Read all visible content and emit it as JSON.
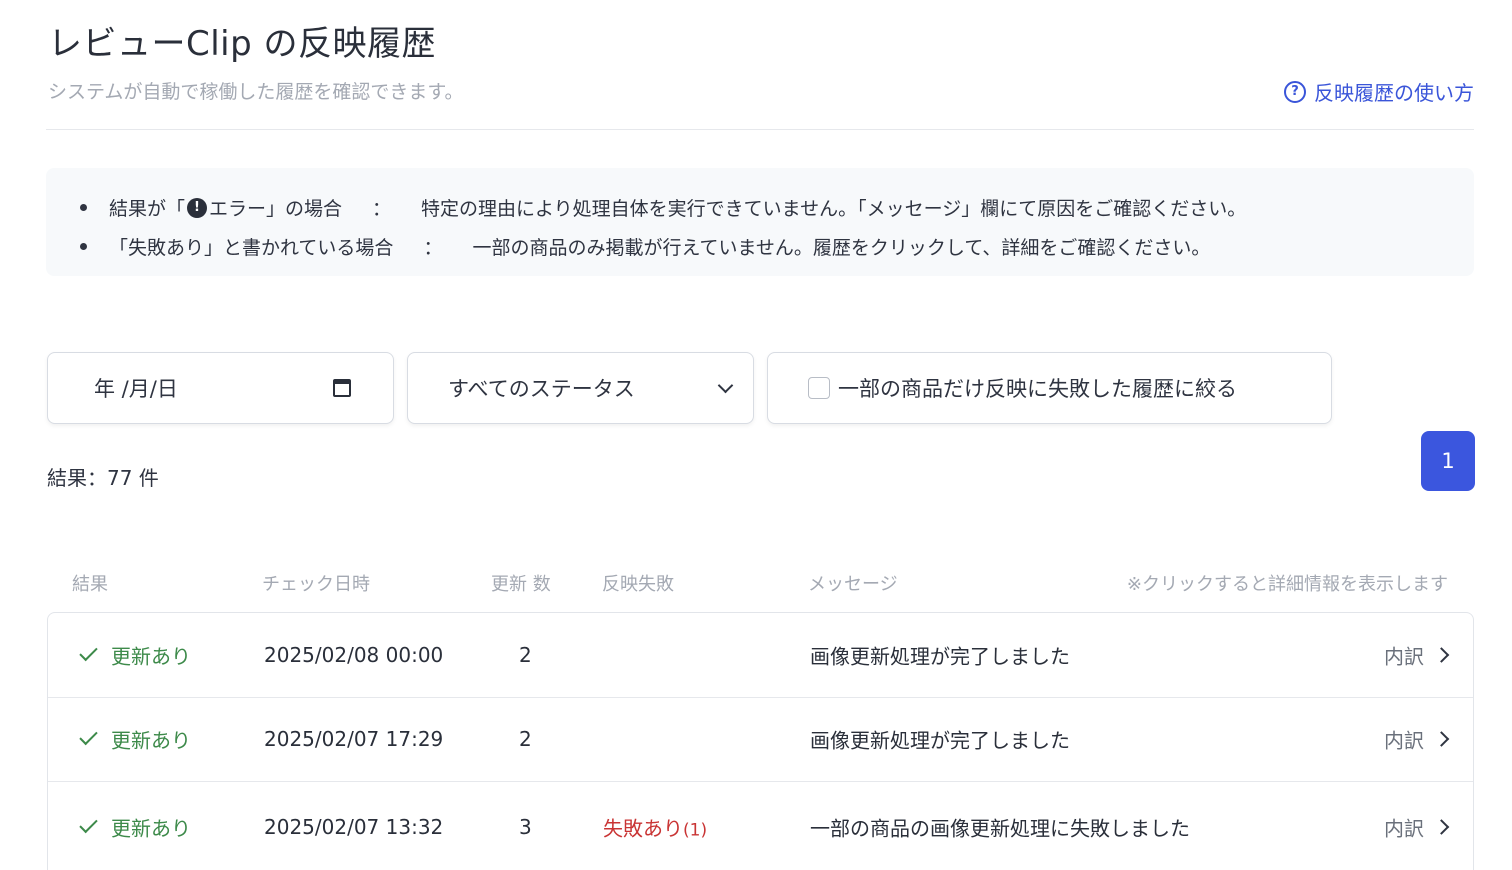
{
  "header": {
    "title": "レビューClip の反映履歴",
    "subtitle": "システムが自動で稼働した履歴を確認できます。",
    "help_link": "反映履歴の使い方",
    "help_icon": "?"
  },
  "notice": {
    "items": [
      {
        "key_prefix": "結果が「",
        "key_icon": "!",
        "key_suffix": " エラー」の場合",
        "separator": "：",
        "text": "特定の理由により処理自体を実行できていません。「メッセージ」欄にて原因をご確認ください。"
      },
      {
        "key": "「失敗あり」と書かれている場合",
        "separator": "：",
        "text": "一部の商品のみ掲載が行えていません。履歴をクリックして、詳細をご確認ください。"
      }
    ]
  },
  "filters": {
    "date_placeholder": "年 /月/日",
    "status_selected": "すべてのステータス",
    "partial_failure_label": "一部の商品だけ反映に失敗した履歴に絞る"
  },
  "results": {
    "count_label": "結果：77 件",
    "current_page": "1"
  },
  "table": {
    "columns": {
      "result": "結果",
      "checked_at": "チェック日時",
      "updates": "更新 数",
      "failures": "反映失敗",
      "message": "メッセージ",
      "note": "※クリックすると詳細情報を表示します"
    },
    "rows": [
      {
        "result": "更新あり",
        "checked_at": "2025/02/08 00:00",
        "updates": "2",
        "failure": "",
        "failure_count": "",
        "message": "画像更新処理が完了しました",
        "detail": "内訳"
      },
      {
        "result": "更新あり",
        "checked_at": "2025/02/07 17:29",
        "updates": "2",
        "failure": "",
        "failure_count": "",
        "message": "画像更新処理が完了しました",
        "detail": "内訳"
      },
      {
        "result": "更新あり",
        "checked_at": "2025/02/07 13:32",
        "updates": "3",
        "failure": "失敗あり",
        "failure_count": "(1)",
        "message": "一部の商品の画像更新処理に失敗しました",
        "detail": "内訳"
      }
    ]
  },
  "colors": {
    "accent": "#3b56de",
    "success": "#3d8a4a",
    "failure": "#c93434"
  }
}
